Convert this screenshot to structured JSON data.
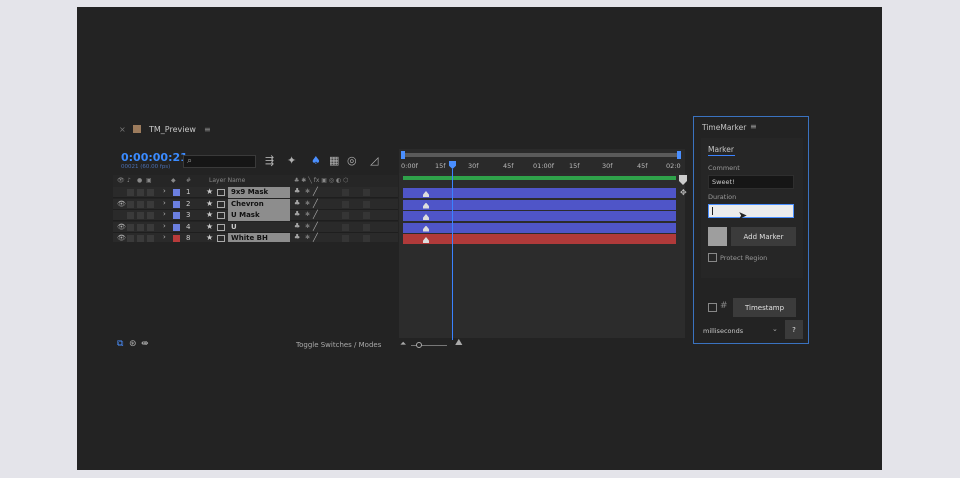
{
  "timeline": {
    "close_glyph": "×",
    "title": "TM_Preview",
    "menu_glyph": "≡",
    "timecode": "0:00:00:21",
    "frames": "00021 (60.00 fps)",
    "search_glyph": "⌕",
    "column_layer_name": "Layer Name",
    "column_number": "#",
    "ruler_ticks": [
      "0:00f",
      "15f",
      "30f",
      "45f",
      "01:00f",
      "15f",
      "30f",
      "45f",
      "02:0"
    ],
    "toggle_label": "Toggle Switches / Modes",
    "layers": [
      {
        "num": "1",
        "name": "9x9 Mask",
        "label_color": "#6b7fe0",
        "visible": false,
        "bar_color": "#4f55c8",
        "highlight": true
      },
      {
        "num": "2",
        "name": "Chevron",
        "label_color": "#6b7fe0",
        "visible": true,
        "bar_color": "#4f55c8",
        "highlight": true
      },
      {
        "num": "3",
        "name": "U Mask",
        "label_color": "#6b7fe0",
        "visible": false,
        "bar_color": "#4f55c8",
        "highlight": true
      },
      {
        "num": "4",
        "name": "U",
        "label_color": "#6b7fe0",
        "visible": true,
        "bar_color": "#4f55c8",
        "highlight": false
      },
      {
        "num": "8",
        "name": "White BH",
        "label_color": "#b83b3b",
        "visible": true,
        "bar_color": "#b03a3a",
        "highlight": true
      }
    ]
  },
  "timemarker": {
    "title": "TimeMarker",
    "menu_glyph": "≡",
    "tab": "Marker",
    "comment_label": "Comment",
    "comment_value": "Sweet!",
    "duration_label": "Duration",
    "duration_value": "",
    "add_marker": "Add Marker",
    "protect_region": "Protect Region",
    "timestamp": "Timestamp",
    "units": "milliseconds",
    "help": "?"
  },
  "colors": {
    "accent": "#3b82ff",
    "app_bg": "#232323"
  }
}
